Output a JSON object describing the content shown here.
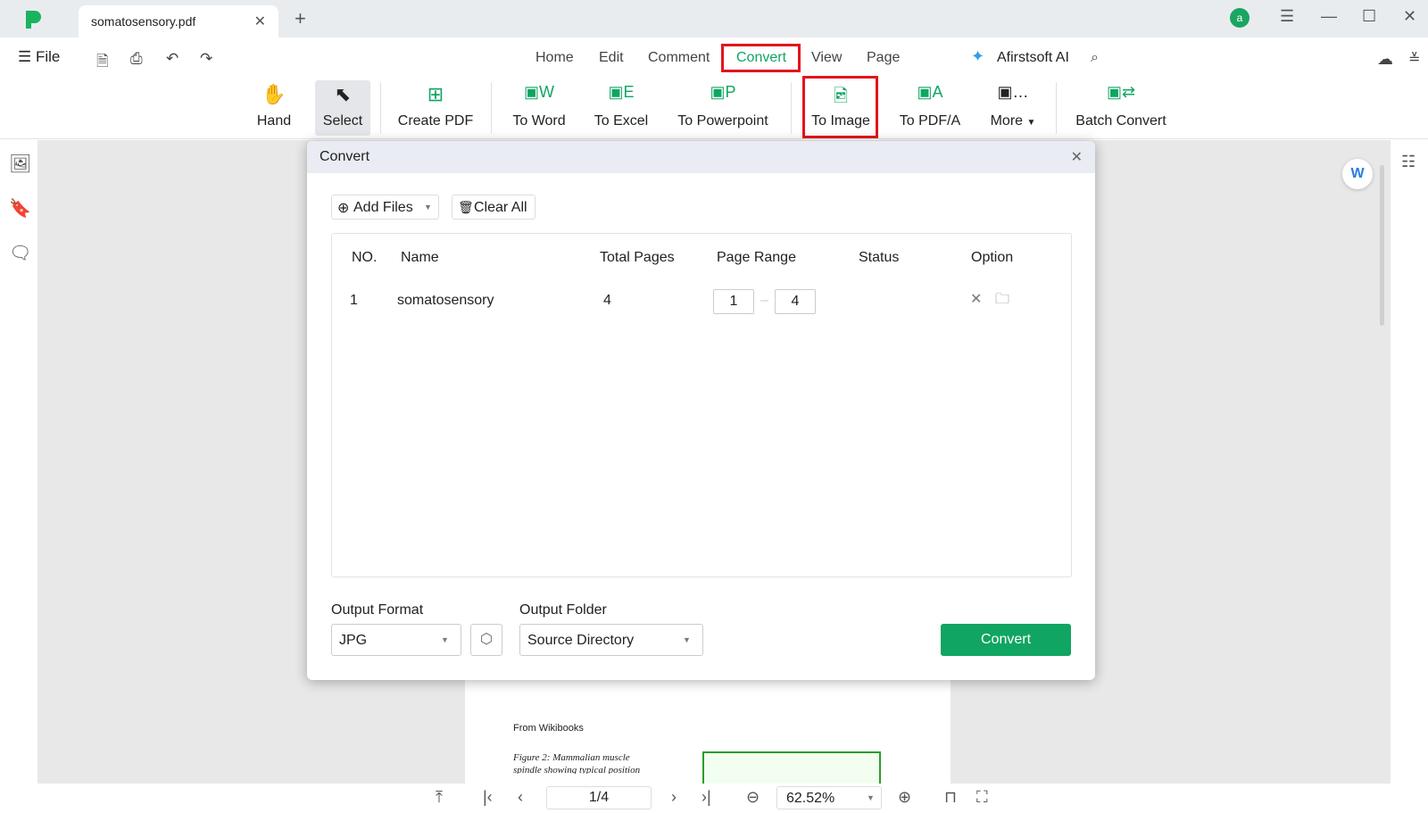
{
  "app": {
    "tab_title": "somatosensory.pdf",
    "avatar_letter": "a",
    "accent": "#10a562",
    "highlight": "#e3151b"
  },
  "menubar": {
    "file": "File",
    "tabs": [
      "Home",
      "Edit",
      "Comment",
      "Convert",
      "View",
      "Page"
    ],
    "active_tab": "Convert",
    "ai": "Afirstsoft AI"
  },
  "ribbon": {
    "items": [
      "Hand",
      "Select",
      "Create PDF",
      "To Word",
      "To Excel",
      "To Powerpoint",
      "To Image",
      "To PDF/A",
      "More",
      "Batch Convert"
    ]
  },
  "dialog": {
    "title": "Convert",
    "add_files": "Add Files",
    "clear_all": "Clear All",
    "columns": [
      "NO.",
      "Name",
      "Total Pages",
      "Page Range",
      "Status",
      "Option"
    ],
    "rows": [
      {
        "no": "1",
        "name": "somatosensory",
        "total_pages": "4",
        "range_from": "1",
        "range_to": "4",
        "status": ""
      }
    ],
    "output_format_label": "Output Format",
    "output_format": "JPG",
    "output_folder_label": "Output Folder",
    "output_folder": "Source Directory",
    "convert": "Convert"
  },
  "document": {
    "source": "From Wikibooks",
    "caption1": "Figure 2:  Mammalian muscle",
    "caption2": "spindle showing typical position"
  },
  "statusbar": {
    "page": "1/4",
    "zoom": "62.52%"
  }
}
